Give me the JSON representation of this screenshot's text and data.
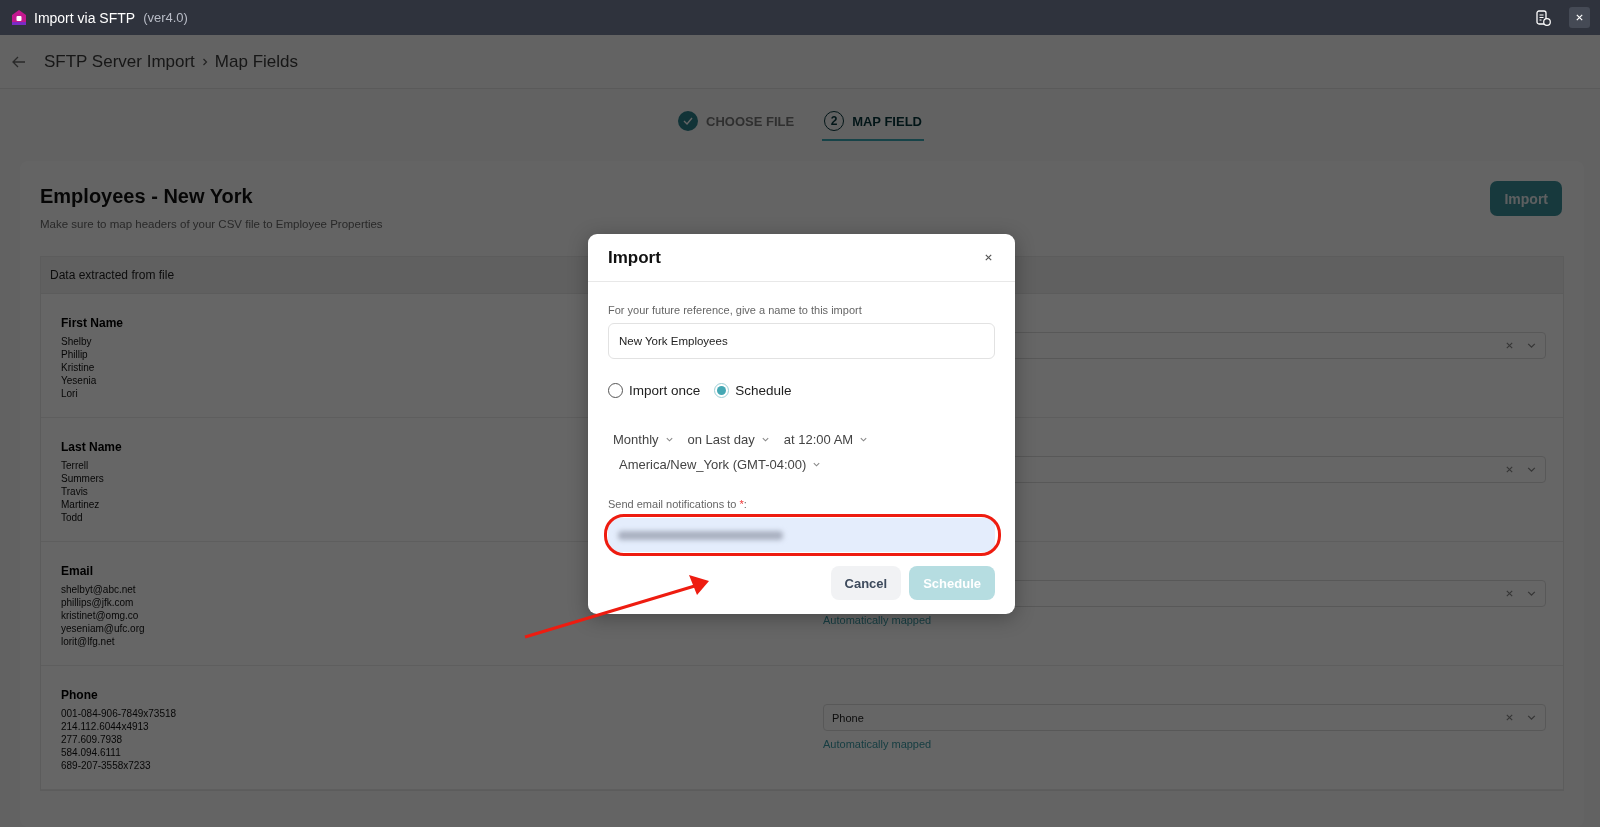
{
  "window": {
    "title": "Import via SFTP",
    "version": "(ver4.0)"
  },
  "header": {
    "breadcrumb": [
      "SFTP Server Import",
      "Map Fields"
    ]
  },
  "steps": [
    {
      "label": "CHOOSE FILE",
      "done": true,
      "selected": false
    },
    {
      "label": "MAP FIELD",
      "number": "2",
      "done": false,
      "selected": true
    }
  ],
  "page": {
    "title": "Employees - New York",
    "subtitle": "Make sure to map headers of your CSV file to Employee Properties",
    "import_button": "Import"
  },
  "table": {
    "header": "Data extracted from file",
    "rows": [
      {
        "name": "First Name",
        "samples": [
          "Shelby",
          "Phillip",
          "Kristine",
          "Yesenia",
          "Lori"
        ],
        "mapping": {}
      },
      {
        "name": "Last Name",
        "samples": [
          "Terrell",
          "Summers",
          "Travis",
          "Martinez",
          "Todd"
        ],
        "mapping": {}
      },
      {
        "name": "Email",
        "samples": [
          "shelbyt@abc.net",
          "phillips@jfk.com",
          "kristinet@omg.co",
          "yeseniam@ufc.org",
          "lorit@lfg.net"
        ],
        "mapping": {
          "note": "Automatically mapped"
        }
      },
      {
        "name": "Phone",
        "samples": [
          "001-084-906-7849x73518",
          "214.112.6044x4913",
          "277.609.7938",
          "584.094.6111",
          "689-207-3558x7233"
        ],
        "mapping": {
          "value": "Phone",
          "note": "Automatically mapped"
        }
      }
    ]
  },
  "modal": {
    "title": "Import",
    "name_label": "For your future reference, give a name to this import",
    "name_value": "New York Employees",
    "options": [
      {
        "label": "Import once",
        "selected": false
      },
      {
        "label": "Schedule",
        "selected": true
      }
    ],
    "schedule": [
      "Monthly",
      "on Last day",
      "at 12:00 AM",
      "America/New_York (GMT-04:00)"
    ],
    "email_label": "Send email notifications to",
    "required_mark": "*",
    "email_label_end": ":",
    "buttons": [
      {
        "label": "Cancel",
        "kind": "secondary",
        "disabled": false
      },
      {
        "label": "Schedule",
        "kind": "primary",
        "disabled": true
      }
    ]
  }
}
